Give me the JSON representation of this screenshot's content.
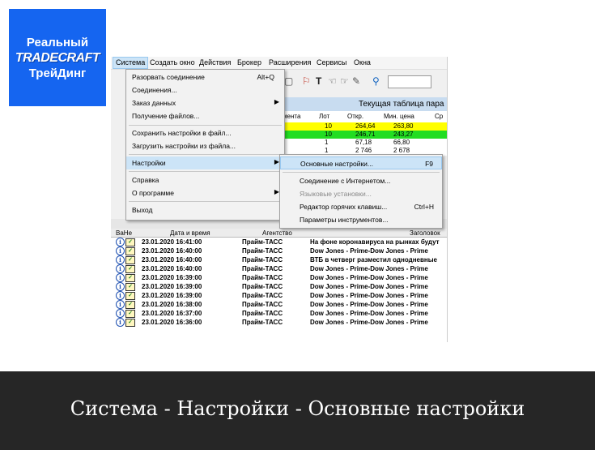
{
  "logo": {
    "line1": "Реальный",
    "line2": "TRADECRAFT",
    "line3": "ТрейДинг"
  },
  "menubar": [
    "Система",
    "Создать окно",
    "Действия",
    "Брокер",
    "Расширения",
    "Сервисы",
    "Окна"
  ],
  "system_menu": {
    "disconnect": "Разорвать соединение",
    "disconnect_shortcut": "Alt+Q",
    "connections": "Соединения...",
    "orders": "Заказ данных",
    "get_files": "Получение файлов...",
    "save_settings": "Сохранить настройки в файл...",
    "load_settings": "Загрузить настройки из файла...",
    "settings": "Настройки",
    "help": "Справка",
    "about": "О программе",
    "exit": "Выход"
  },
  "settings_submenu": {
    "main": "Основные настройки...",
    "main_shortcut": "F9",
    "internet": "Соединение с Интернетом...",
    "language": "Языковые установки...",
    "hotkeys": "Редактор горячих клавиш...",
    "hotkeys_shortcut": "Ctrl+H",
    "instruments": "Параметры инструментов..."
  },
  "top_table": {
    "title": "Текущая таблица пара",
    "headers": [
      "мента",
      "Лот",
      "Откр.",
      "Мин. цена",
      "Ср"
    ],
    "rows": [
      {
        "lot": "10",
        "open": "264,64",
        "min": "263,80",
        "color": "#ffff00"
      },
      {
        "lot": "10",
        "open": "246,71",
        "min": "243,27",
        "color": "#22dd22"
      },
      {
        "lot": "1",
        "open": "67,18",
        "min": "66,80",
        "color": "#ffffff"
      },
      {
        "lot": "1",
        "open": "2 746",
        "min": "2 678",
        "color": "#ffffff"
      }
    ]
  },
  "news_table": {
    "headers": [
      "ВаНе",
      "Дата и время",
      "Агентство",
      "Заголовок"
    ],
    "rows": [
      {
        "datetime": "23.01.2020 16:41:00",
        "agency": "Прайм-ТАСС",
        "title": "На фоне коронавируса на рынках будут"
      },
      {
        "datetime": "23.01.2020 16:40:00",
        "agency": "Прайм-ТАСС",
        "title": "Dow Jones - Prime-Dow Jones - Prime"
      },
      {
        "datetime": "23.01.2020 16:40:00",
        "agency": "Прайм-ТАСС",
        "title": "ВТБ в четверг разместил однодневные"
      },
      {
        "datetime": "23.01.2020 16:40:00",
        "agency": "Прайм-ТАСС",
        "title": "Dow Jones - Prime-Dow Jones - Prime"
      },
      {
        "datetime": "23.01.2020 16:39:00",
        "agency": "Прайм-ТАСС",
        "title": "Dow Jones - Prime-Dow Jones - Prime"
      },
      {
        "datetime": "23.01.2020 16:39:00",
        "agency": "Прайм-ТАСС",
        "title": "Dow Jones - Prime-Dow Jones - Prime"
      },
      {
        "datetime": "23.01.2020 16:39:00",
        "agency": "Прайм-ТАСС",
        "title": "Dow Jones - Prime-Dow Jones - Prime"
      },
      {
        "datetime": "23.01.2020 16:38:00",
        "agency": "Прайм-ТАСС",
        "title": "Dow Jones - Prime-Dow Jones - Prime"
      },
      {
        "datetime": "23.01.2020 16:37:00",
        "agency": "Прайм-ТАСС",
        "title": "Dow Jones - Prime-Dow Jones - Prime"
      },
      {
        "datetime": "23.01.2020 16:36:00",
        "agency": "Прайм-ТАСС",
        "title": "Dow Jones - Prime-Dow Jones - Prime"
      }
    ]
  },
  "caption": "Система - Настройки - Основные настройки",
  "colors": {
    "logo_bg": "#1565f0",
    "highlight": "#cce4f7",
    "caption_bg": "#262626"
  }
}
